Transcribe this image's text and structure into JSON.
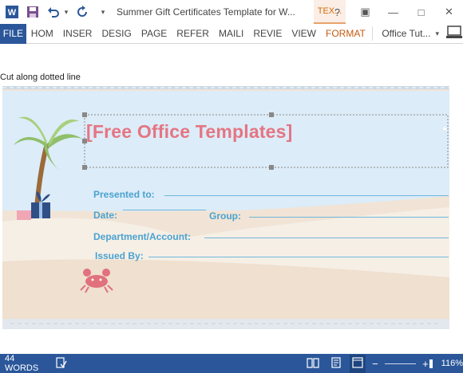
{
  "titlebar": {
    "title": "Summer Gift Certificates Template for W...",
    "context_tab": "TEX...",
    "window_buttons": [
      "?",
      "▣",
      "—",
      "□",
      "✕"
    ]
  },
  "ribbon": {
    "file": "FILE",
    "tabs": [
      "HOM",
      "INSER",
      "DESIG",
      "PAGE",
      "REFER",
      "MAILI",
      "REVIE",
      "VIEW",
      "FORMAT"
    ],
    "account": "Office Tut...",
    "account_caret": "▾"
  },
  "document": {
    "cut_label": "Cut along dotted line",
    "heading": "[Free Office Templates]",
    "fields": {
      "presented_to": "Presented to:",
      "date": "Date:",
      "group": "Group:",
      "department": "Department/Account:",
      "issued_by": "Issued By:"
    }
  },
  "status": {
    "words": "44 WORDS",
    "zoom": "116%",
    "zoom_minus": "−",
    "zoom_plus": "+"
  },
  "colors": {
    "brand": "#2b579a",
    "heading": "#e57583",
    "label": "#4aa2d0",
    "sky": "#dcecf8",
    "sand": "#f1e4d6"
  }
}
